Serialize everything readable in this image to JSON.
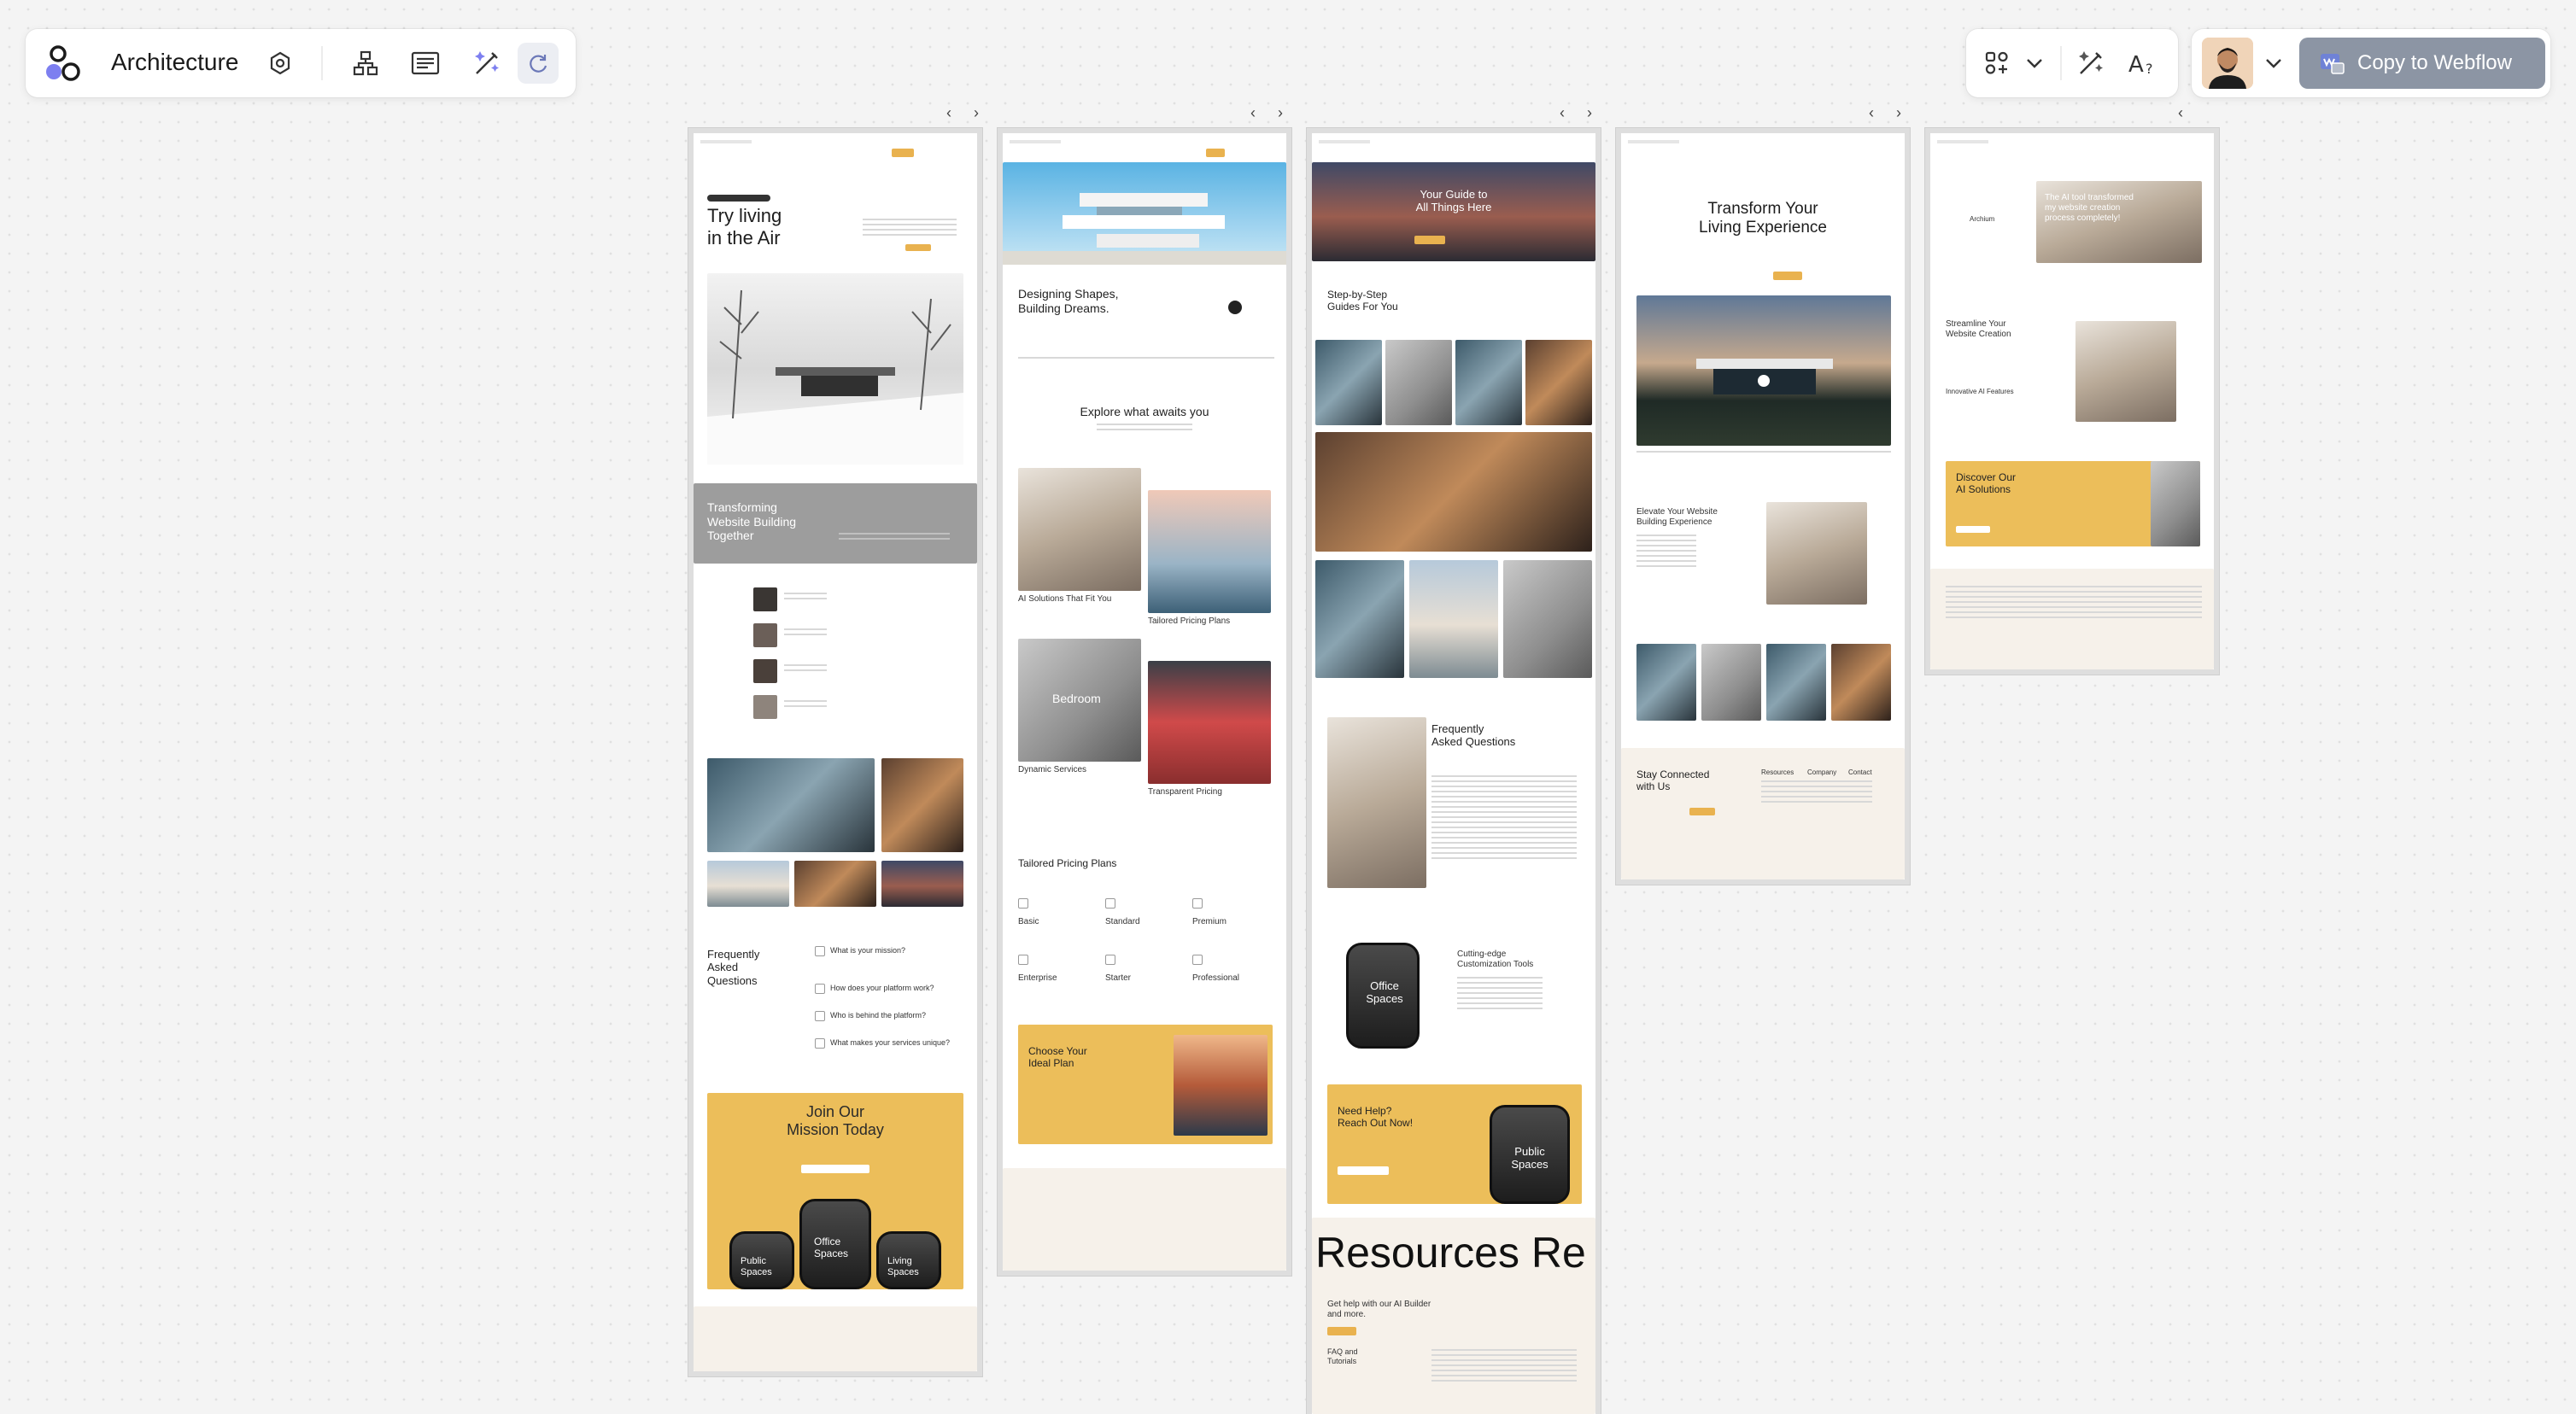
{
  "toolbar": {
    "project_title": "Architecture",
    "copy_button_label": "Copy to Webflow",
    "icons": [
      "app-logo-icon",
      "settings-hexagon-icon",
      "sitemap-icon",
      "layout-icon",
      "ai-brush-icon",
      "refresh-icon",
      "components-icon",
      "chevron-down-icon",
      "ai-style-icon",
      "font-ai-icon",
      "user-avatar",
      "webflow-icon"
    ]
  },
  "frames": {
    "f1": {
      "badge": "",
      "hero_title_1": "Try living",
      "hero_title_2": "in the Air",
      "band_1": "Transforming",
      "band_2": "Website Building",
      "band_3": "Together",
      "faq_1": "Frequently",
      "faq_2": "Asked",
      "faq_3": "Questions",
      "faq_items": [
        "What is your mission?",
        "How does your platform work?",
        "Who is behind the platform?",
        "What makes your services unique?"
      ],
      "cta_1": "Join Our",
      "cta_2": "Mission Today",
      "phone_labels": [
        "Public Spaces",
        "Office Spaces",
        "Living Spaces"
      ]
    },
    "f2": {
      "hero_1": "Designing Shapes,",
      "hero_2": "Building Dreams.",
      "explore": "Explore what awaits you",
      "cards": [
        "AI Solutions That Fit You",
        "Tailored Pricing Plans",
        "Dynamic Services",
        "Transparent Pricing"
      ],
      "bedroom": "Bedroom",
      "pricing_title": "Tailored Pricing Plans",
      "plans": [
        "Basic",
        "Standard",
        "Premium",
        "Enterprise",
        "Starter",
        "Professional"
      ],
      "cta_1": "Choose Your",
      "cta_2": "Ideal Plan"
    },
    "f3": {
      "hero_1": "Your Guide to",
      "hero_2": "All Things Here",
      "guides_1": "Step-by-Step",
      "guides_2": "Guides For You",
      "faq_1": "Frequently",
      "faq_2": "Asked Questions",
      "phone_1": "Office",
      "phone_2": "Spaces",
      "tools_1": "Cutting-edge",
      "tools_2": "Customization Tools",
      "help_1": "Need Help?",
      "help_2": "Reach Out Now!",
      "phone2_1": "Public",
      "phone2_2": "Spaces",
      "resources": "Resources Re",
      "res_sub_1": "Get help with our AI Builder",
      "res_sub_2": "and more.",
      "faq_tag_1": "FAQ and",
      "faq_tag_2": "Tutorials"
    },
    "f4": {
      "hero_1": "Transform Your",
      "hero_2": "Living Experience",
      "elevate_1": "Elevate Your Website",
      "elevate_2": "Building Experience",
      "stay_1": "Stay Connected",
      "stay_2": "with Us",
      "footer_cols": [
        "Resources",
        "Company",
        "Contact"
      ]
    },
    "f5": {
      "brand": "Archium",
      "hero_1": "The AI tool transformed",
      "hero_2": "my website creation",
      "hero_3": "process completely!",
      "stream_1": "Streamline Your",
      "stream_2": "Website Creation",
      "innovative": "Innovative AI Features",
      "discover_1": "Discover Our",
      "discover_2": "AI Solutions"
    }
  }
}
